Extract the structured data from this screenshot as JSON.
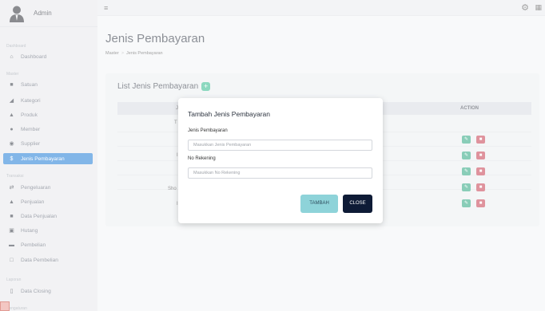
{
  "brand": {
    "name": "Admin"
  },
  "sidebar": {
    "sections": [
      {
        "label": "Dashboard"
      },
      {
        "label": "Master"
      },
      {
        "label": "Transaksi"
      },
      {
        "label": "Laporan"
      },
      {
        "label": "Pengaturan"
      }
    ],
    "items": [
      {
        "label": "Dashboard",
        "icon": "home-icon"
      },
      {
        "label": "Satuan",
        "icon": "folder-icon"
      },
      {
        "label": "Kategori",
        "icon": "folder-open-icon"
      },
      {
        "label": "Produk",
        "icon": "flask-icon"
      },
      {
        "label": "Member",
        "icon": "user-icon"
      },
      {
        "label": "Supplier",
        "icon": "users-icon"
      },
      {
        "label": "Jenis Pembayaran",
        "icon": "dollar-icon",
        "active": true
      },
      {
        "label": "Pengeluaran",
        "icon": "exchange-icon"
      },
      {
        "label": "Penjualan",
        "icon": "flask-icon"
      },
      {
        "label": "Data Penjualan",
        "icon": "folder-icon"
      },
      {
        "label": "Hutang",
        "icon": "card-icon"
      },
      {
        "label": "Pembelian",
        "icon": "truck-icon"
      },
      {
        "label": "Data Pembelian",
        "icon": "box-icon"
      },
      {
        "label": "Data Closing",
        "icon": "file-icon"
      }
    ]
  },
  "page": {
    "title": "Jenis Pembayaran",
    "breadcrumb": [
      "Master",
      "Jenis Pembayaran"
    ]
  },
  "card": {
    "title": "List Jenis Pembayaran",
    "column_action": "ACTION",
    "visible_cell_fragments": [
      "J",
      "T",
      "I",
      "Sho",
      "I"
    ]
  },
  "modal": {
    "title": "Tambah Jenis Pembayaran",
    "field1_label": "Jenis Pembayaran",
    "field1_placeholder": "Masukkan Jenis Pembayaran",
    "field2_label": "No Rekening",
    "field2_placeholder": "Masukkan No Rekening",
    "submit_label": "TAMBAH",
    "close_label": "CLOSE"
  },
  "colors": {
    "active_nav": "#1d7bd6",
    "edit_button": "#28a57e",
    "delete_button": "#c53b4e",
    "tambah_button": "#8ed3d9",
    "close_button": "#0e1b36"
  }
}
